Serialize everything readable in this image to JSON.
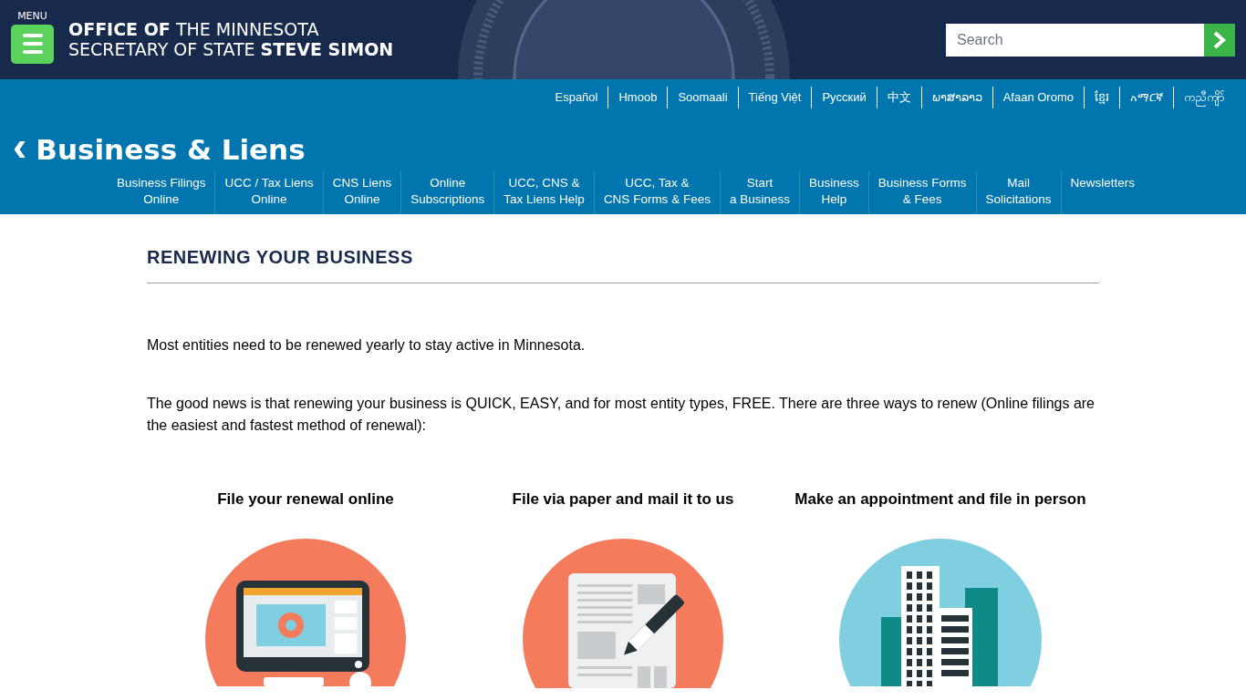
{
  "header": {
    "menu_label": "MENU",
    "title_lines": [
      "**OFFICE OF** THE MINNESOTA",
      "SECRETARY OF STATE **STEVE SIMON**"
    ],
    "search": {
      "placeholder": "Search"
    }
  },
  "languages": [
    "Español",
    "Hmoob",
    "Soomaali",
    "Tiếng Việt",
    "Русский",
    "中文",
    "ພາສາລາວ",
    "Afaan Oromo",
    "ខ្មែរ",
    "አማርኛ",
    "ကညီကျိာ်"
  ],
  "section": {
    "back_icon": "‹",
    "title": "Business & Liens"
  },
  "nav": [
    {
      "lines": [
        "Business Filings",
        "Online"
      ]
    },
    {
      "lines": [
        "UCC / Tax Liens",
        "Online"
      ]
    },
    {
      "lines": [
        "CNS Liens",
        "Online"
      ]
    },
    {
      "lines": [
        "Online",
        "Subscriptions"
      ]
    },
    {
      "lines": [
        "UCC, CNS &",
        "Tax Liens Help"
      ]
    },
    {
      "lines": [
        "UCC, Tax &",
        "CNS Forms & Fees"
      ]
    },
    {
      "lines": [
        "Start",
        "a Business"
      ]
    },
    {
      "lines": [
        "Business",
        "Help"
      ]
    },
    {
      "lines": [
        "Business Forms",
        "& Fees"
      ]
    },
    {
      "lines": [
        "Mail",
        "Solicitations"
      ]
    },
    {
      "lines": [
        "Newsletters"
      ]
    }
  ],
  "content": {
    "heading": "RENEWING YOUR BUSINESS",
    "paragraphs": [
      "Most entities need to be renewed yearly to stay active in Minnesota.",
      "The good news is that renewing your business is QUICK, EASY, and for most entity types, FREE. There are three ways to renew (Online filings are the easiest and fastest method of renewal):"
    ],
    "options": [
      {
        "title": "File your renewal online",
        "kind": "computer"
      },
      {
        "title": "File via paper and mail it to us",
        "kind": "paper"
      },
      {
        "title": "Make an appointment and file in person",
        "kind": "building"
      }
    ]
  }
}
